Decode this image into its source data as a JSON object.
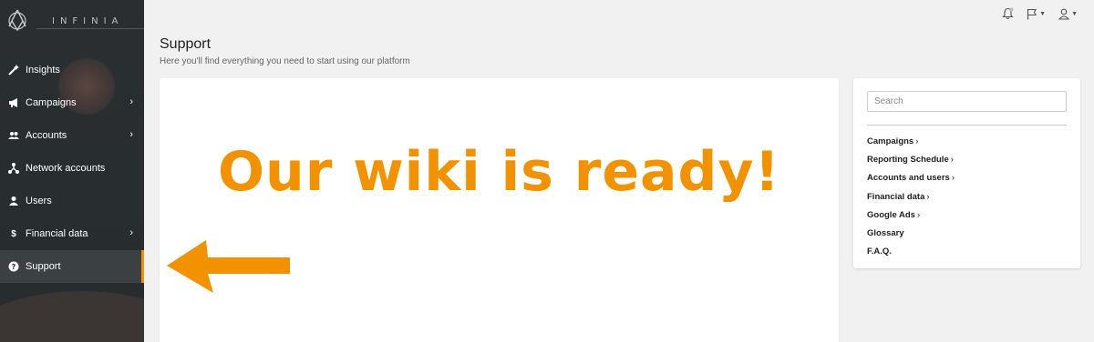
{
  "brand": {
    "name": "INFINIA"
  },
  "sidebar": {
    "items": [
      {
        "label": "Insights",
        "icon": "magic-wand-icon",
        "has_chevron": false
      },
      {
        "label": "Campaigns",
        "icon": "megaphone-icon",
        "has_chevron": true
      },
      {
        "label": "Accounts",
        "icon": "users-icon",
        "has_chevron": true
      },
      {
        "label": "Network accounts",
        "icon": "network-icon",
        "has_chevron": false
      },
      {
        "label": "Users",
        "icon": "user-icon",
        "has_chevron": false
      },
      {
        "label": "Financial data",
        "icon": "dollar-icon",
        "has_chevron": true
      },
      {
        "label": "Support",
        "icon": "question-circle-icon",
        "has_chevron": false,
        "active": true
      }
    ],
    "chevron_glyph": "›"
  },
  "topbar": {
    "icons": [
      "bell-icon",
      "flag-icon",
      "user-icon"
    ]
  },
  "header": {
    "title": "Support",
    "subtitle": "Here you'll find everything you need to start using our platform"
  },
  "main": {
    "headline": "Our wiki is ready!",
    "accent_color": "#f39200"
  },
  "side_panel": {
    "search_placeholder": "Search",
    "links": [
      {
        "label": "Campaigns",
        "arrow": "›"
      },
      {
        "label": "Reporting Schedule",
        "arrow": "›"
      },
      {
        "label": "Accounts and users",
        "arrow": "›"
      },
      {
        "label": "Financial data",
        "arrow": "›"
      },
      {
        "label": "Google Ads",
        "arrow": "›"
      },
      {
        "label": "Glossary",
        "arrow": ""
      },
      {
        "label": "F.A.Q.",
        "arrow": ""
      }
    ]
  }
}
